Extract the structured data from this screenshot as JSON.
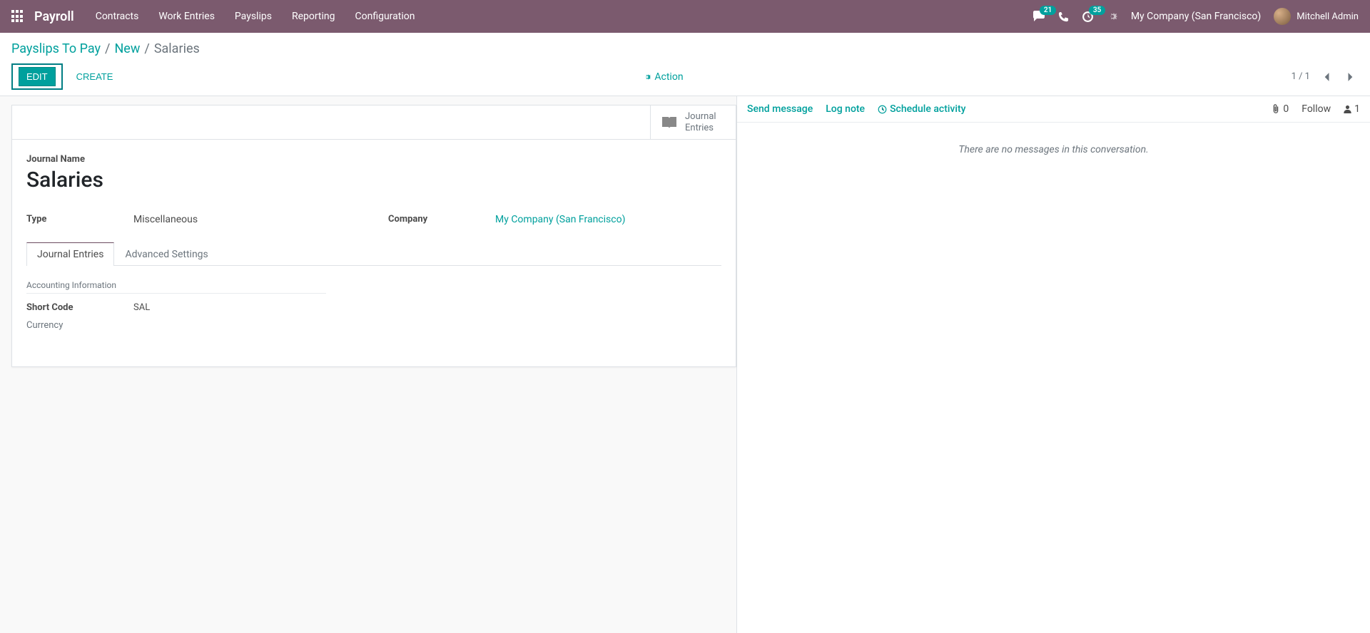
{
  "navbar": {
    "app_name": "Payroll",
    "menu": [
      "Contracts",
      "Work Entries",
      "Payslips",
      "Reporting",
      "Configuration"
    ],
    "messages_badge": "21",
    "activities_badge": "35",
    "company": "My Company (San Francisco)",
    "user": "Mitchell Admin"
  },
  "breadcrumb": {
    "parent1": "Payslips To Pay",
    "parent2": "New",
    "current": "Salaries"
  },
  "buttons": {
    "edit": "EDIT",
    "create": "CREATE",
    "action": "Action"
  },
  "pager": {
    "text": "1 / 1"
  },
  "stat_button": {
    "label_line1": "Journal",
    "label_line2": "Entries"
  },
  "form": {
    "journal_name_label": "Journal Name",
    "journal_name": "Salaries",
    "type_label": "Type",
    "type_value": "Miscellaneous",
    "company_label": "Company",
    "company_value": "My Company (San Francisco)"
  },
  "tabs": {
    "t1": "Journal Entries",
    "t2": "Advanced Settings"
  },
  "tab_content": {
    "section": "Accounting Information",
    "short_code_label": "Short Code",
    "short_code_value": "SAL",
    "currency_label": "Currency"
  },
  "chatter": {
    "send_message": "Send message",
    "log_note": "Log note",
    "schedule_activity": "Schedule activity",
    "attachments": "0",
    "follow": "Follow",
    "followers": "1",
    "empty": "There are no messages in this conversation."
  }
}
